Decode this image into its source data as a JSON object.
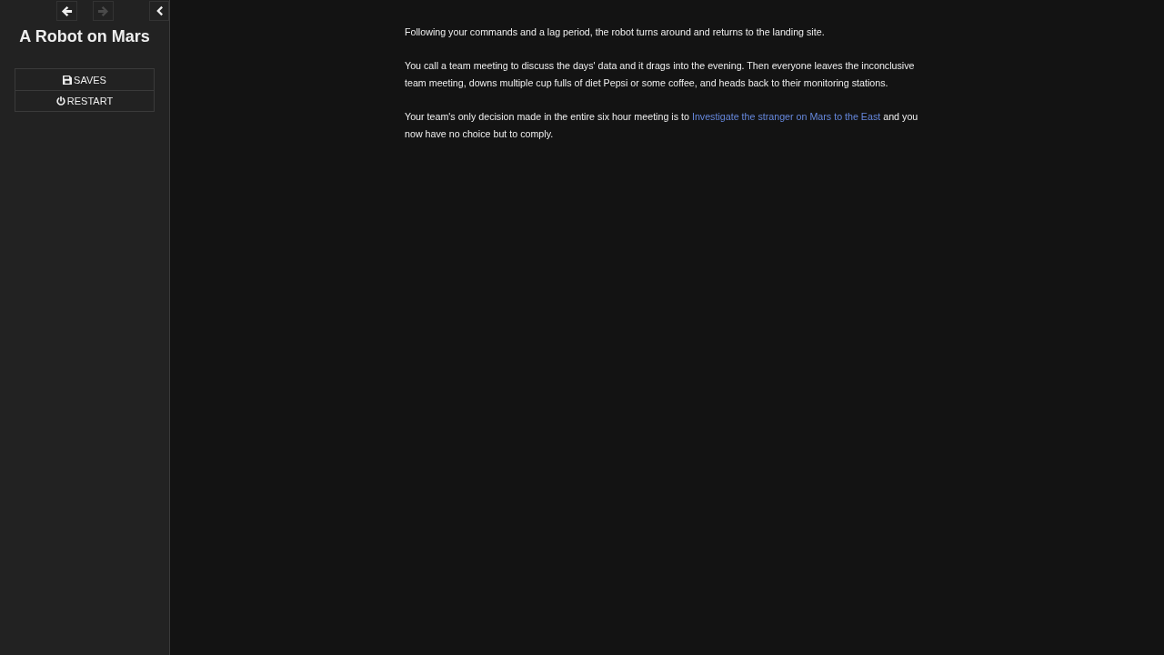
{
  "history": [
    {
      "kind": "back",
      "disabled": false
    },
    {
      "kind": "forward",
      "disabled": true
    }
  ],
  "story_title": "A Robot on Mars",
  "menu": [
    {
      "kind": "saves",
      "label": "SAVES"
    },
    {
      "kind": "restart",
      "label": "RESTART"
    }
  ],
  "passage": {
    "paragraphs": [
      [
        {
          "kind": "text",
          "text": "Following your commands and a lag period, the robot turns around and returns to the landing site."
        }
      ],
      [
        {
          "kind": "text",
          "text": "You call a team meeting to discuss the days' data and it drags into the evening. Then everyone leaves the inconclusive team meeting, downs multiple cup fulls of diet Pepsi or some coffee, and heads back to their monitoring stations."
        }
      ],
      [
        {
          "kind": "text",
          "text": "Your team's only decision made in the entire six hour meeting is to "
        },
        {
          "kind": "link",
          "text": "Investigate the stranger on Mars to the East"
        },
        {
          "kind": "text",
          "text": " and you now have no choice but to comply."
        }
      ]
    ]
  }
}
